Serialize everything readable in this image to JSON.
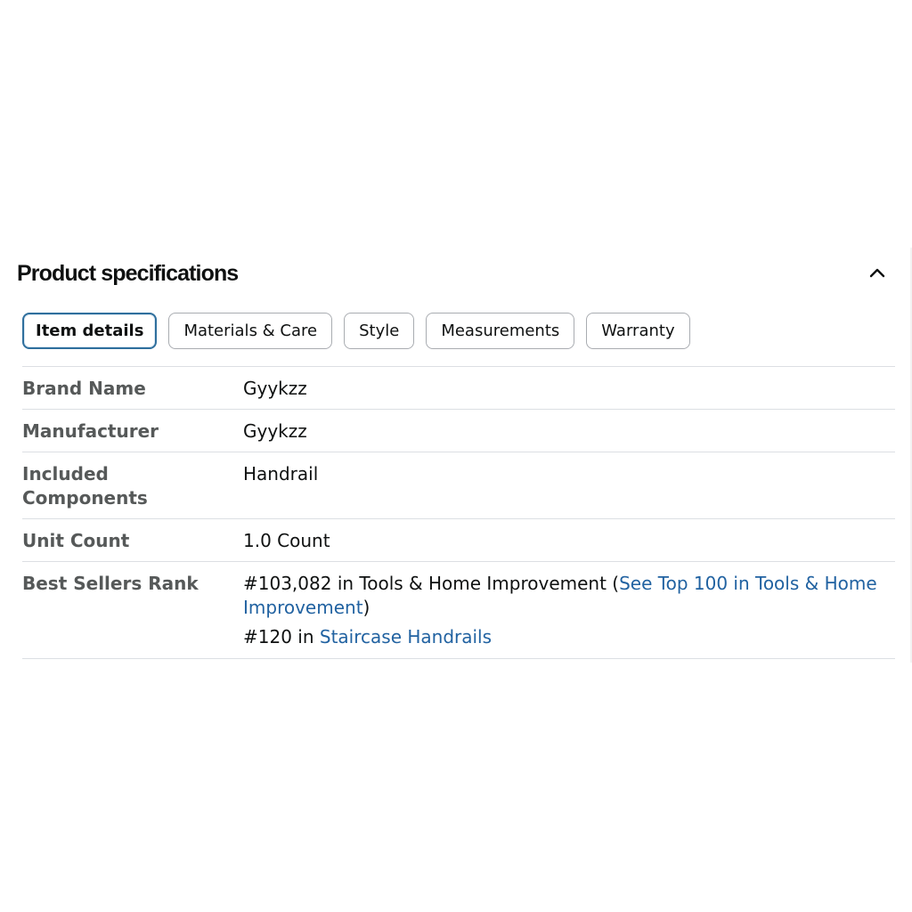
{
  "section": {
    "title": "Product specifications",
    "collapse_icon": "chevron-up-icon"
  },
  "tabs": [
    {
      "label": "Item details",
      "active": true
    },
    {
      "label": "Materials & Care",
      "active": false
    },
    {
      "label": "Style",
      "active": false
    },
    {
      "label": "Measurements",
      "active": false
    },
    {
      "label": "Warranty",
      "active": false
    }
  ],
  "specs": {
    "brand": {
      "label": "Brand Name",
      "value": "Gyykzz"
    },
    "manufacturer": {
      "label": "Manufacturer",
      "value": "Gyykzz"
    },
    "components": {
      "label": "Included Components",
      "value": "Handrail"
    },
    "unit_count": {
      "label": "Unit Count",
      "value": "1.0 Count"
    },
    "best_sellers": {
      "label": "Best Sellers Rank",
      "rank1_prefix": "#103,082 in Tools & Home Improvement (",
      "rank1_link": "See Top 100 in Tools & Home Improvement",
      "rank1_suffix": ")",
      "rank2_prefix": "#120 in ",
      "rank2_link": "Staircase Handrails"
    }
  },
  "colors": {
    "link": "#2162a1",
    "active_tab_border": "#2f6f9d",
    "label": "#565959",
    "divider": "#dcdfe3"
  }
}
